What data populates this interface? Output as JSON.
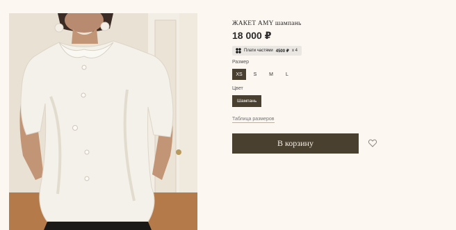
{
  "product": {
    "title": "ЖАКЕТ AMY шампань",
    "price": "18 000 ₽",
    "installments": {
      "prefix": "Плати частями",
      "amount": "4500 ₽",
      "multiplier": "x 4",
      "icon": "split-payment-icon"
    },
    "photo": {
      "description_icon": "product-photo"
    }
  },
  "size": {
    "label": "Размер",
    "options": [
      "XS",
      "S",
      "M",
      "L"
    ],
    "selected": "XS"
  },
  "color": {
    "label": "Цвет",
    "selected": "Шампань"
  },
  "links": {
    "size_table": "Таблица размеров"
  },
  "actions": {
    "add_to_cart": "В корзину",
    "wishlist_icon": "heart-icon"
  },
  "colors": {
    "background": "#fcf7f1",
    "accent": "#4a4030",
    "badge_bg": "#eae7e3"
  }
}
